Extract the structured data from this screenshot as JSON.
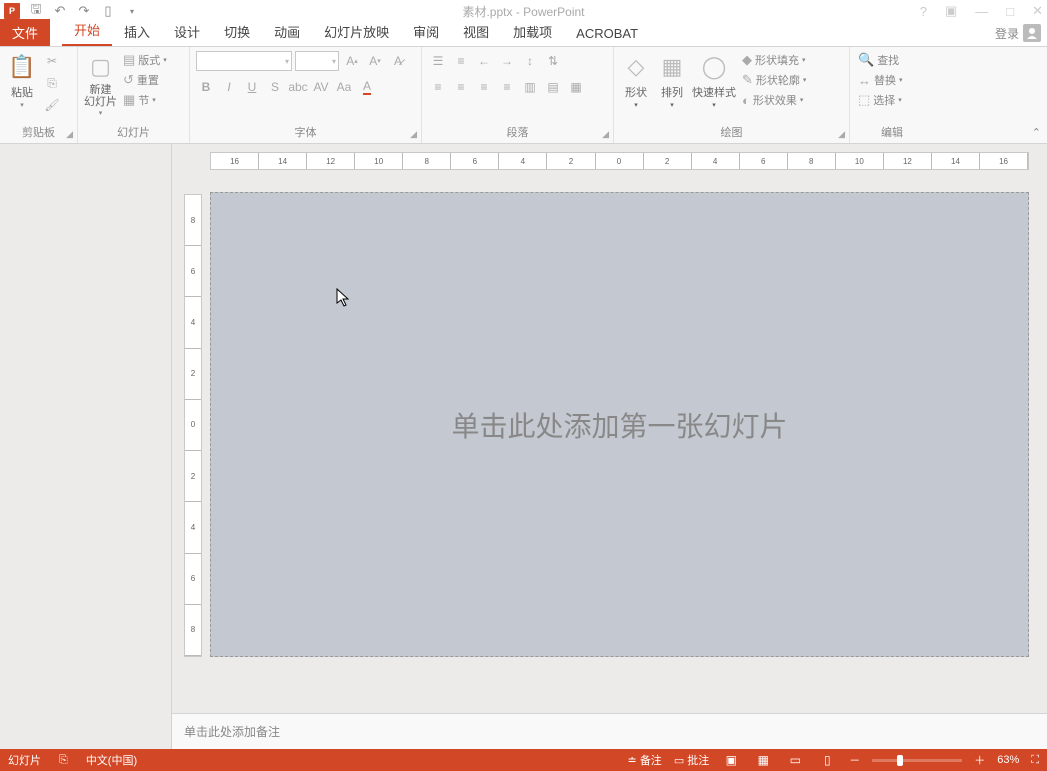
{
  "titlebar": {
    "title": "素材.pptx - PowerPoint"
  },
  "tabs": {
    "file": "文件",
    "home": "开始",
    "insert": "插入",
    "design": "设计",
    "transitions": "切换",
    "animations": "动画",
    "slideshow": "幻灯片放映",
    "review": "审阅",
    "view": "视图",
    "addins": "加载项",
    "acrobat": "ACROBAT",
    "account": "登录"
  },
  "clipboard": {
    "paste": "粘贴",
    "group": "剪贴板"
  },
  "slides": {
    "new_slide": "新建\n幻灯片",
    "layout": "版式",
    "reset": "重置",
    "section": "节",
    "group": "幻灯片"
  },
  "font": {
    "group": "字体"
  },
  "paragraph": {
    "group": "段落"
  },
  "drawing": {
    "shapes": "形状",
    "arrange": "排列",
    "quickstyle": "快速样式",
    "fill": "形状填充",
    "outline": "形状轮廓",
    "effects": "形状效果",
    "group": "绘图"
  },
  "editing": {
    "find": "查找",
    "replace": "替换",
    "select": "选择",
    "group": "编辑"
  },
  "canvas": {
    "placeholder": "单击此处添加第一张幻灯片"
  },
  "notes": {
    "placeholder": "单击此处添加备注"
  },
  "ruler": {
    "hmarks": [
      "16",
      "14",
      "12",
      "10",
      "8",
      "6",
      "4",
      "2",
      "0",
      "2",
      "4",
      "6",
      "8",
      "10",
      "12",
      "14",
      "16"
    ],
    "vmarks": [
      "8",
      "6",
      "4",
      "2",
      "0",
      "2",
      "4",
      "6",
      "8"
    ]
  },
  "status": {
    "slide": "幻灯片",
    "lang": "中文(中国)",
    "notes": "备注",
    "comments": "批注",
    "zoom": "63%"
  }
}
